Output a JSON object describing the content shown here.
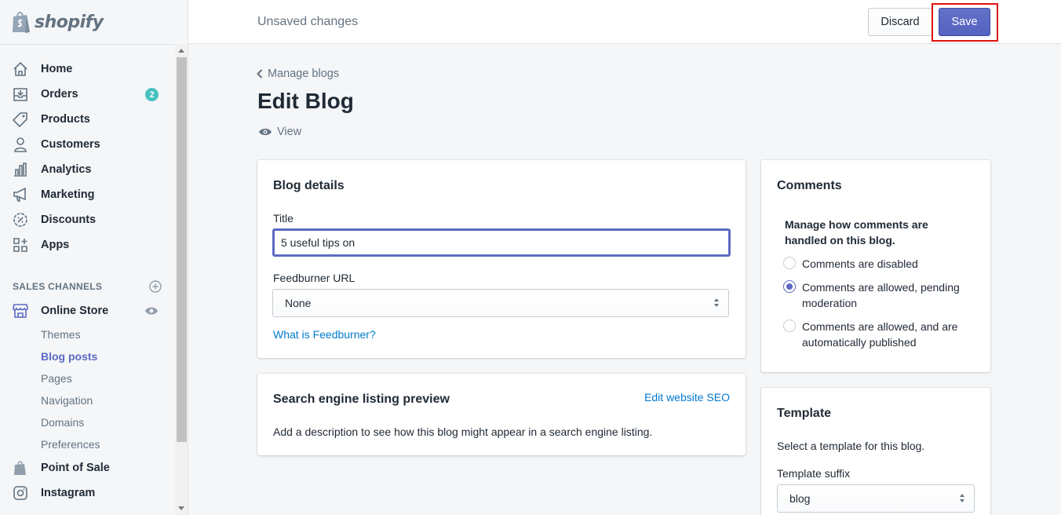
{
  "brand": {
    "name": "shopify"
  },
  "topbar": {
    "status": "Unsaved changes",
    "discard_label": "Discard",
    "save_label": "Save"
  },
  "sidebar": {
    "items": [
      {
        "label": "Home",
        "icon": "home-icon"
      },
      {
        "label": "Orders",
        "icon": "orders-icon",
        "badge": "2"
      },
      {
        "label": "Products",
        "icon": "tag-icon"
      },
      {
        "label": "Customers",
        "icon": "person-icon"
      },
      {
        "label": "Analytics",
        "icon": "bar-chart-icon"
      },
      {
        "label": "Marketing",
        "icon": "megaphone-icon"
      },
      {
        "label": "Discounts",
        "icon": "discount-icon"
      },
      {
        "label": "Apps",
        "icon": "apps-icon"
      }
    ],
    "section_label": "SALES CHANNELS",
    "online_store": {
      "label": "Online Store",
      "icon": "store-icon"
    },
    "sub_items": [
      {
        "label": "Themes",
        "active": false
      },
      {
        "label": "Blog posts",
        "active": true
      },
      {
        "label": "Pages",
        "active": false
      },
      {
        "label": "Navigation",
        "active": false
      },
      {
        "label": "Domains",
        "active": false
      },
      {
        "label": "Preferences",
        "active": false
      }
    ],
    "channels": [
      {
        "label": "Point of Sale",
        "icon": "pos-icon"
      },
      {
        "label": "Instagram",
        "icon": "instagram-icon"
      }
    ]
  },
  "page": {
    "breadcrumb": "Manage blogs",
    "title": "Edit Blog",
    "view_label": "View"
  },
  "blog_details": {
    "heading": "Blog details",
    "title_label": "Title",
    "title_value": "5 useful tips on",
    "feedburner_label": "Feedburner URL",
    "feedburner_value": "None",
    "feedburner_help": "What is Feedburner?"
  },
  "seo": {
    "heading": "Search engine listing preview",
    "edit_link": "Edit website SEO",
    "description": "Add a description to see how this blog might appear in a search engine listing."
  },
  "comments": {
    "heading": "Comments",
    "subheading": "Manage how comments are handled on this blog.",
    "options": [
      {
        "label": "Comments are disabled",
        "checked": false
      },
      {
        "label": "Comments are allowed, pending moderation",
        "checked": true
      },
      {
        "label": "Comments are allowed, and are automatically published",
        "checked": false
      }
    ]
  },
  "template": {
    "heading": "Template",
    "description": "Select a template for this blog.",
    "suffix_label": "Template suffix",
    "suffix_value": "blog"
  },
  "colors": {
    "accent": "#5c6ac4",
    "link": "#007ace",
    "badge": "#47c1bf",
    "highlight": "#e0100f"
  }
}
